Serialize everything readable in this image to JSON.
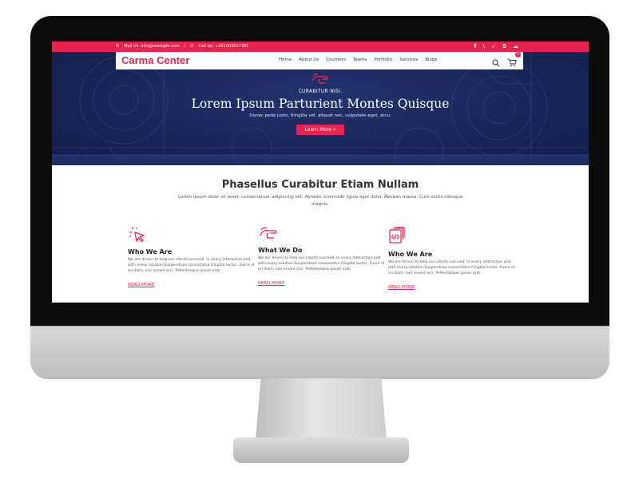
{
  "colors": {
    "accent": "#e8234d",
    "hero_bg": "#18265a",
    "screen_bg": "#ffffff"
  },
  "topbar": {
    "mail": "Mail Us: info@example.com",
    "call": "Call Us: +201003557381",
    "social_icons": [
      "facebook-icon",
      "rss-icon",
      "twitter-icon",
      "skype-icon",
      "soundcloud-icon"
    ]
  },
  "header": {
    "logo": "Carma Center",
    "menu": [
      "Home",
      "About Us",
      "Counters",
      "Teams",
      "Portfolio",
      "Services",
      "Blogs"
    ],
    "cart_count": "0"
  },
  "hero": {
    "subtitle": "CURABITUR NISI.",
    "title": "Lorem Ipsum Parturient Montes Quisque",
    "description": "Donec pede justo, fringilla vel, aliquet nec, vulputate eget, arcu.",
    "button": "Learn More  »"
  },
  "intro": {
    "title": "Phasellus Curabitur Etiam Nullam",
    "description": "Lorem ipsum dolor sit amet, consectetuer adipiscing elit. Aenean commodo ligula eget dolor. Aenean massa. Cum sociis natoque magnis."
  },
  "features": [
    {
      "icon": "cursor-click-icon",
      "title": "Who We Are",
      "text": "We are driven to help our clients succeed. In every interaction and with every solution.Suspendisse consectetur fringilla luctus. Fusce id mi diam, non ornare orci. Pellentesque ipsum erat.",
      "link": "READ MORE"
    },
    {
      "icon": "hand-pointer-icon",
      "title": "What We Do",
      "text": "We are driven to help our clients succeed. In every interaction and with every solution.Suspendisse consectetur fringilla luctus. Fusce id mi diam, non ornare orci. Pellentesque ipsum erat.",
      "link": "READ MORE"
    },
    {
      "icon": "code-file-icon",
      "title": "Who We Are",
      "text": "We are driven to help our clients succeed. In every interaction and with every solution.Suspendisse consectetur fringilla luctus. Fusce id mi diam, non ornare orci. Pellentesque ipsum erat.",
      "link": "READ MORE"
    }
  ]
}
